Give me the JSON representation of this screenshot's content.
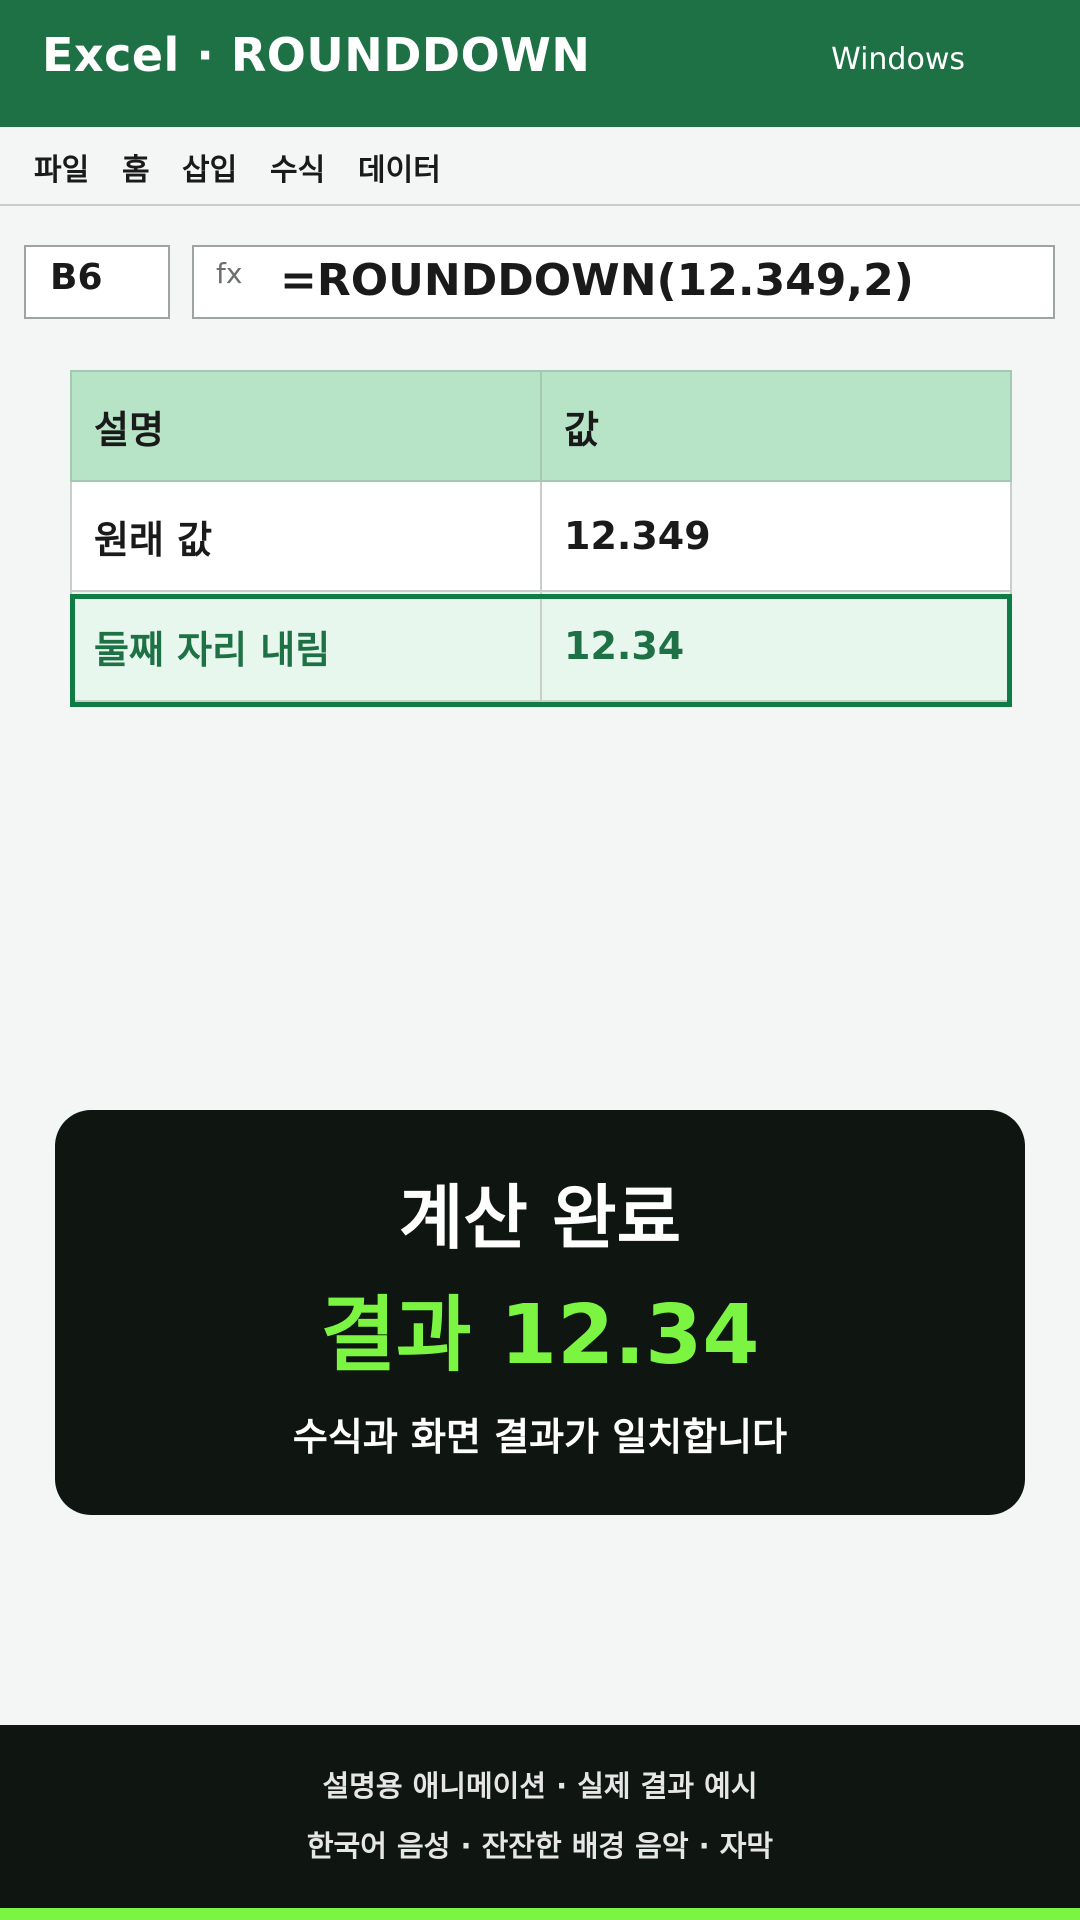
{
  "header": {
    "title": "Excel · ROUNDDOWN",
    "platform": "Windows"
  },
  "menu": {
    "items": [
      "파일",
      "홈",
      "삽입",
      "수식",
      "데이터"
    ]
  },
  "formula_bar": {
    "cell_ref": "B6",
    "fx_label": "fx",
    "formula": "=ROUNDDOWN(12.349,2)"
  },
  "table": {
    "headers": [
      "설명",
      "값"
    ],
    "rows": [
      [
        "원래 값",
        "12.349"
      ],
      [
        "둘째 자리 내림",
        "12.34"
      ]
    ]
  },
  "result_card": {
    "title": "계산 완료",
    "value": "결과  12.34",
    "subtitle": "수식과 화면 결과가 일치합니다"
  },
  "footer": {
    "line1": "설명용 애니메이션 · 실제 결과 예시",
    "line2": "한국어 음성 · 잔잔한 배경 음악 · 자막"
  },
  "colors": {
    "brand": "#1e7145",
    "accent": "#7cf542",
    "highlight_border": "#0f7b45"
  }
}
